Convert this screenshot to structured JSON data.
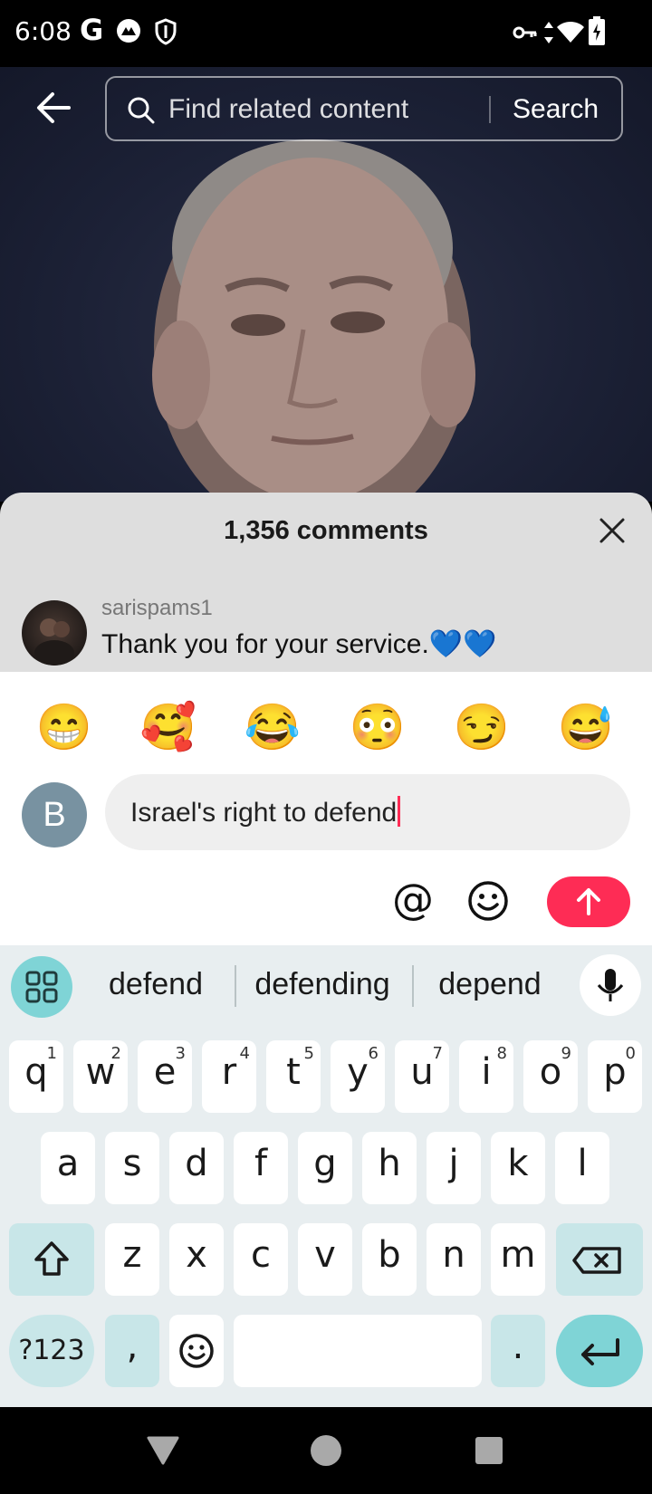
{
  "status_bar": {
    "time": "6:08",
    "carrier_glyph": "G",
    "icons": [
      "google-icon",
      "app-notification-icon",
      "shield-icon",
      "vpn-key-icon",
      "data-arrows-icon",
      "wifi-icon",
      "battery-icon"
    ]
  },
  "header": {
    "search_placeholder": "Find related content",
    "search_button": "Search"
  },
  "comments": {
    "title": "1,356 comments",
    "items": [
      {
        "username": "sarispams1",
        "text": "Thank you for your service.💙💙"
      }
    ]
  },
  "composer": {
    "quick_emojis": [
      "😁",
      "🥰",
      "😂",
      "😳",
      "😏",
      "😅"
    ],
    "avatar_letter": "B",
    "input_value": "Israel's right to defend",
    "at_symbol": "@"
  },
  "keyboard": {
    "suggestions": [
      "defend",
      "defending",
      "depend"
    ],
    "row1": [
      {
        "k": "q",
        "s": "1"
      },
      {
        "k": "w",
        "s": "2"
      },
      {
        "k": "e",
        "s": "3"
      },
      {
        "k": "r",
        "s": "4"
      },
      {
        "k": "t",
        "s": "5"
      },
      {
        "k": "y",
        "s": "6"
      },
      {
        "k": "u",
        "s": "7"
      },
      {
        "k": "i",
        "s": "8"
      },
      {
        "k": "o",
        "s": "9"
      },
      {
        "k": "p",
        "s": "0"
      }
    ],
    "row2": [
      "a",
      "s",
      "d",
      "f",
      "g",
      "h",
      "j",
      "k",
      "l"
    ],
    "row3": [
      "z",
      "x",
      "c",
      "v",
      "b",
      "n",
      "m"
    ],
    "symbols_key": "?123",
    "comma_key": ",",
    "period_key": "."
  },
  "colors": {
    "accent": "#fe2c55",
    "keyboard_accent": "#7fd4d6",
    "sheet_bg": "#dedede"
  }
}
